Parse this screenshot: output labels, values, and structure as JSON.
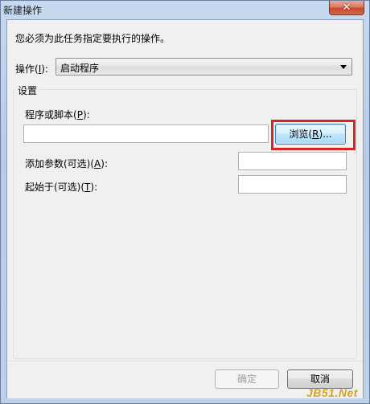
{
  "window": {
    "title": "新建操作",
    "close_symbol": "✕"
  },
  "dialog": {
    "instruction": "您必须为此任务指定要执行的操作。",
    "action": {
      "label_prefix": "操作(",
      "label_accel": "I",
      "label_suffix": "):",
      "selected_value": "启动程序"
    },
    "settings": {
      "legend": "设置",
      "program": {
        "label_prefix": "程序或脚本(",
        "label_accel": "P",
        "label_suffix": "):",
        "value": ""
      },
      "browse": {
        "label_prefix": "浏览(",
        "label_accel": "R",
        "label_suffix": ")..."
      },
      "arguments": {
        "label_prefix": "添加参数(可选)(",
        "label_accel": "A",
        "label_suffix": "):",
        "value": ""
      },
      "start_in": {
        "label_prefix": "起始于(可选)(",
        "label_accel": "T",
        "label_suffix": "):",
        "value": ""
      }
    },
    "buttons": {
      "ok": "确定",
      "cancel": "取消"
    }
  },
  "watermark": "JB51.Net",
  "colors": {
    "highlight_border": "#d92424",
    "browse_button": "#bee6fd",
    "watermark": "#d8a01c"
  },
  "icons": {
    "close": "close-icon",
    "dropdown": "chevron-down-icon"
  }
}
